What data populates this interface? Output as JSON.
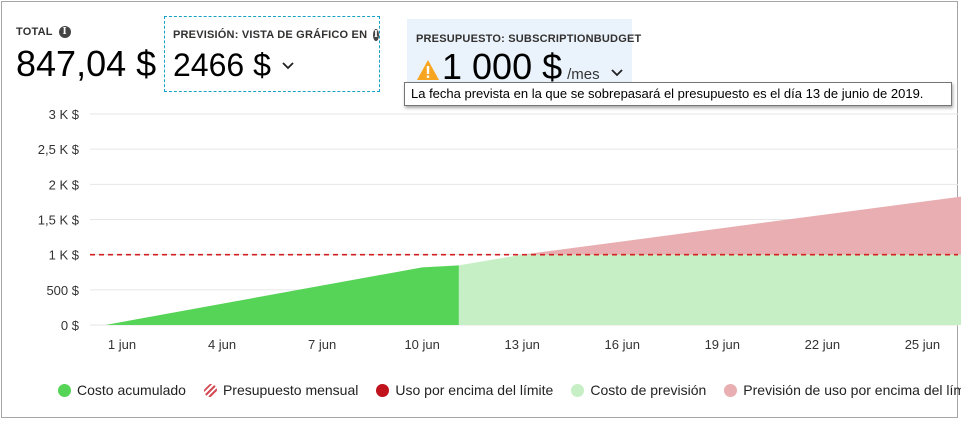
{
  "summary": {
    "total_label": "TOTAL",
    "total_value": "847,04 $",
    "forecast_label": "PREVISIÓN: VISTA DE GRÁFICO EN",
    "forecast_value": "2466 $",
    "budget_label": "PRESUPUESTO: SUBSCRIPTIONBUDGET",
    "budget_value": "1 000 $",
    "budget_unit": "/mes"
  },
  "tooltip": "La fecha prevista en la que se sobrepasará el presupuesto es el día 13 de junio de 2019.",
  "icons": {
    "info": "info-icon",
    "warning": "warning-icon",
    "chevron": "chevron-down-icon"
  },
  "colors": {
    "actual": "#56d458",
    "forecast": "#c6efc6",
    "over_forecast": "#e8aeb1",
    "budget_line": "#d32020",
    "over_limit": "#c0131b",
    "budget_swatch": "#d44c55",
    "tooltip_border": "#767676",
    "forecast_card_border": "#17a2c4",
    "budget_card_bg": "#eaf3fb"
  },
  "chart_data": {
    "type": "area",
    "x_unit": "day of June",
    "ylim": [
      0,
      3000
    ],
    "xlim": [
      1,
      31
    ],
    "y_ticks": [
      0,
      500,
      1000,
      1500,
      2000,
      2500,
      3000
    ],
    "y_tick_labels": [
      "0 $",
      "500 $",
      "1 K $",
      "1,5 K $",
      "2 K $",
      "2,5 K $",
      "3 K $"
    ],
    "x_ticks": [
      1,
      4,
      7,
      10,
      13,
      16,
      19,
      22,
      25
    ],
    "x_tick_labels": [
      "1 jun",
      "4 jun",
      "7 jun",
      "10 jun",
      "13 jun",
      "16 jun",
      "19 jun",
      "22 jun",
      "25 jun"
    ],
    "budget": 1000,
    "series": [
      {
        "name": "Costo acumulado",
        "x": [
          0.5,
          10.0,
          11.1
        ],
        "values": [
          0,
          820,
          847
        ]
      },
      {
        "name": "Previsión de uso por encima del límite",
        "x": [
          11.1,
          13.0,
          31.0
        ],
        "values": [
          847,
          1000,
          2130
        ]
      }
    ],
    "legend": [
      {
        "label": "Costo acumulado",
        "swatch": "solid",
        "color": "#56d458"
      },
      {
        "label": "Presupuesto mensual",
        "swatch": "hatched",
        "color": "#d44c55"
      },
      {
        "label": "Uso por encima del límite",
        "swatch": "solid",
        "color": "#c0131b"
      },
      {
        "label": "Costo de previsión",
        "swatch": "solid",
        "color": "#c6efc6"
      },
      {
        "label": "Previsión de uso por encima del límite",
        "swatch": "solid",
        "color": "#e8aeb1"
      }
    ],
    "grid": true,
    "legend_position": "bottom"
  }
}
